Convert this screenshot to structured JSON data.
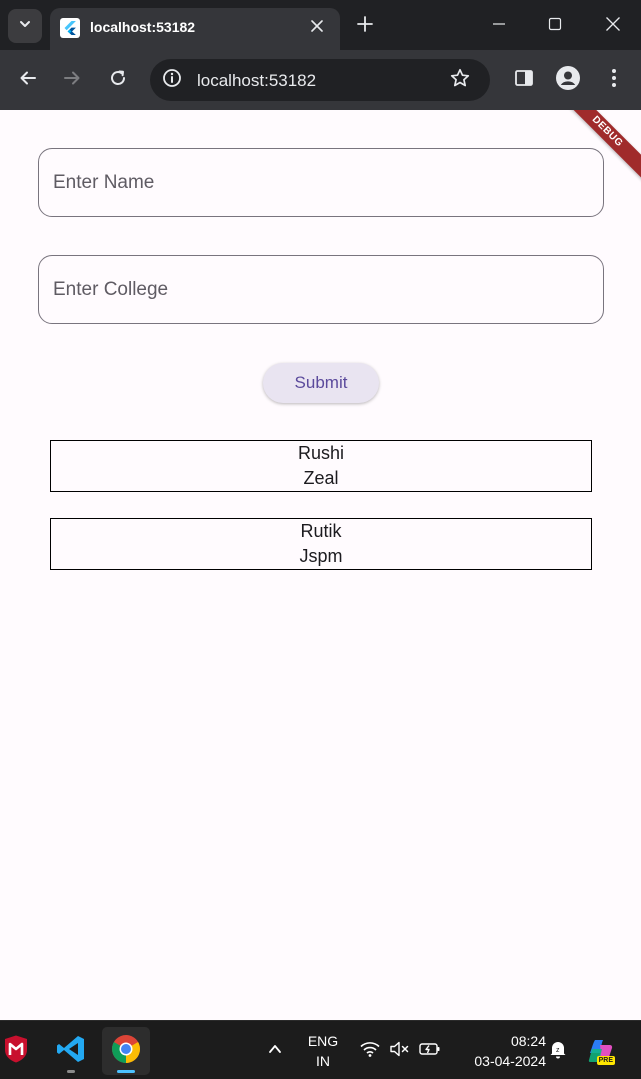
{
  "browser": {
    "tab_title": "localhost:53182",
    "url": "localhost:53182"
  },
  "page": {
    "debug_banner": "DEBUG",
    "name_field": {
      "placeholder": "Enter Name",
      "value": ""
    },
    "college_field": {
      "placeholder": "Enter College",
      "value": ""
    },
    "submit_label": "Submit",
    "records": [
      {
        "name": "Rushi",
        "college": "Zeal"
      },
      {
        "name": "Rutik",
        "college": "Jspm"
      }
    ]
  },
  "taskbar": {
    "language": "ENG",
    "region": "IN",
    "time": "08:24",
    "date": "03-04-2024",
    "copilot_badge": "PRE"
  },
  "colors": {
    "chrome_dark": "#202124",
    "toolbar": "#35363a",
    "page_bg": "#fffbfe",
    "button_bg": "#e9e4f1",
    "button_text": "#5b4a9c",
    "debug_banner": "#a02b2b",
    "taskbar": "#1c1c1c"
  }
}
